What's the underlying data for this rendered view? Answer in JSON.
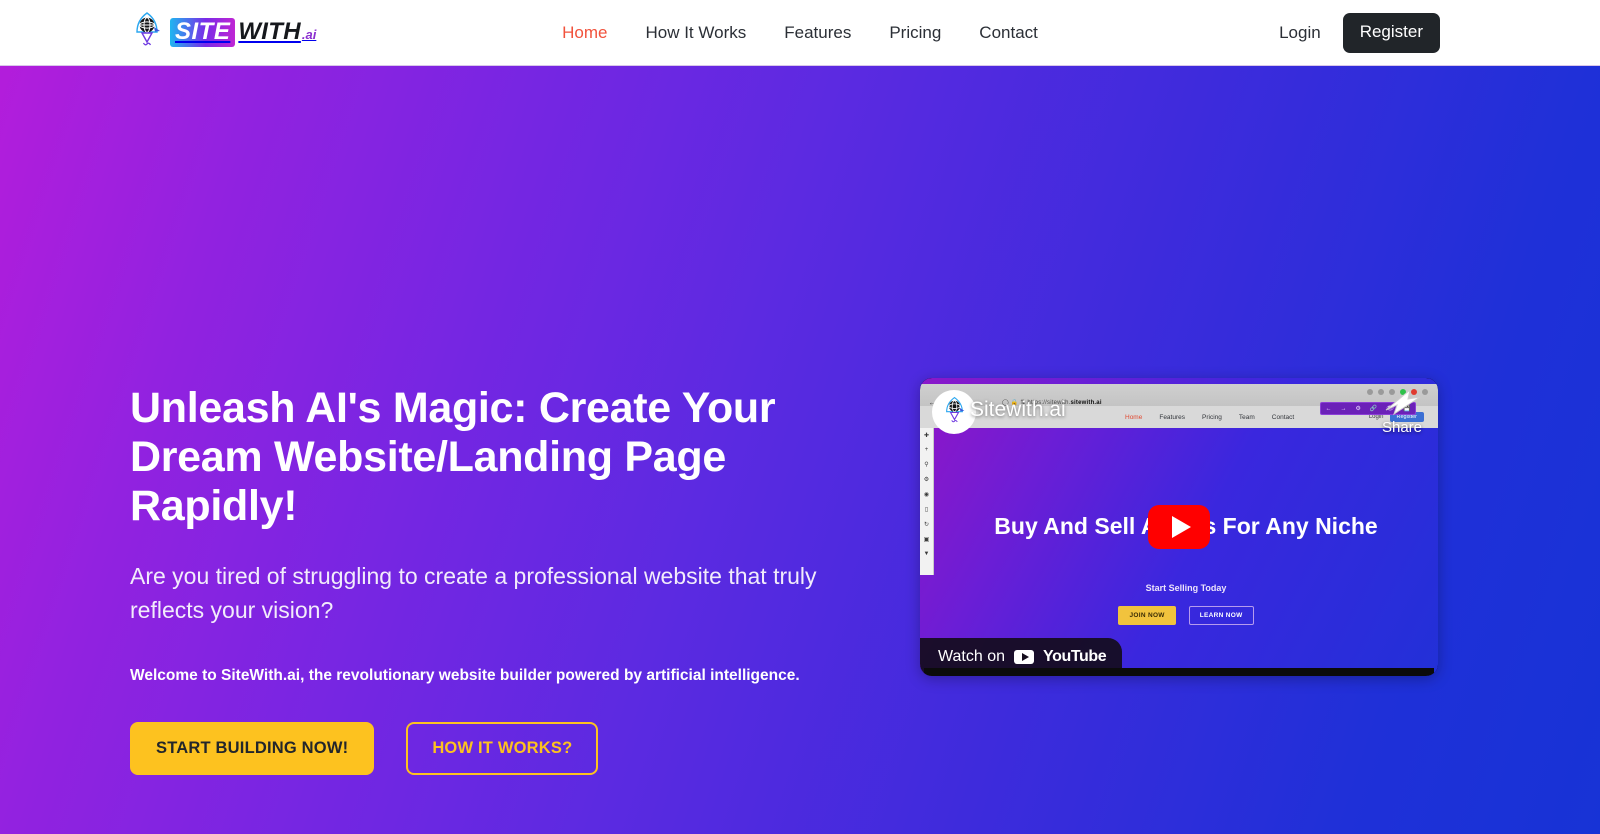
{
  "header": {
    "brand": {
      "icon": "rocket-globe-logo",
      "site": "SITE",
      "with": "WITH",
      "ai": ".ai"
    },
    "nav": [
      {
        "label": "Home",
        "active": true
      },
      {
        "label": "How It Works",
        "active": false
      },
      {
        "label": "Features",
        "active": false
      },
      {
        "label": "Pricing",
        "active": false
      },
      {
        "label": "Contact",
        "active": false
      }
    ],
    "login_label": "Login",
    "register_label": "Register",
    "active_color": "#f1523c"
  },
  "hero": {
    "title": "Unleash AI's Magic: Create Your Dream Website/Landing Page Rapidly!",
    "subtitle": "Are you tired of struggling to create a professional website that truly reflects your vision?",
    "welcome": "Welcome to SiteWith.ai, the revolutionary website builder powered by artificial intelligence.",
    "primary_button": "START BUILDING NOW!",
    "secondary_button": "HOW IT WORKS?",
    "gradient_start": "#b31ddb",
    "gradient_end": "#1733d6",
    "accent_yellow": "#fdc21f"
  },
  "video": {
    "channel_title": "Sitewith.ai",
    "avatar_icon": "rocket-globe-avatar",
    "share_label": "Share",
    "share_icon": "share-arrow-cursor-icon",
    "play_icon": "play-button-icon",
    "watch_prefix": "Watch on",
    "watch_brand": "YouTube",
    "thumbnail": {
      "url_bar": "https://sitewith.ai/",
      "url_bar_bold": "sitewith.ai",
      "nav": [
        "Home",
        "Features",
        "Pricing",
        "Team",
        "Contact"
      ],
      "login": "Login",
      "register": "Register",
      "headline": "Buy And Sell Assets For Any Niche",
      "tagline": "Start Selling Today",
      "cta_primary": "JOIN NOW",
      "cta_secondary": "LEARN NOW",
      "sidebar_icons": [
        "move-icon",
        "plus-icon",
        "search-icon",
        "gear-icon",
        "eye-icon",
        "mobile-icon",
        "refresh-icon",
        "save-icon",
        "download-icon"
      ]
    }
  }
}
